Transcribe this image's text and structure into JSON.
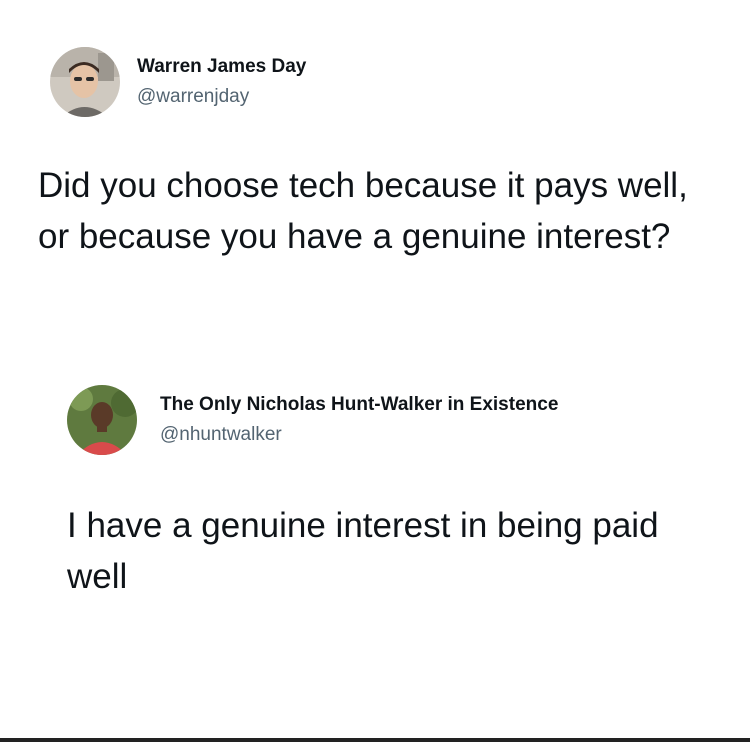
{
  "tweets": [
    {
      "display_name": "Warren James Day",
      "handle": "@warrenjday",
      "text": "Did you choose tech because it pays well, or because you have a genuine interest?"
    },
    {
      "display_name": "The Only Nicholas Hunt-Walker in Existence",
      "handle": "@nhuntwalker",
      "text": "I have a genuine interest in being paid well"
    }
  ],
  "colors": {
    "text_primary": "#0f1419",
    "text_secondary": "#536471",
    "background": "#ffffff"
  }
}
